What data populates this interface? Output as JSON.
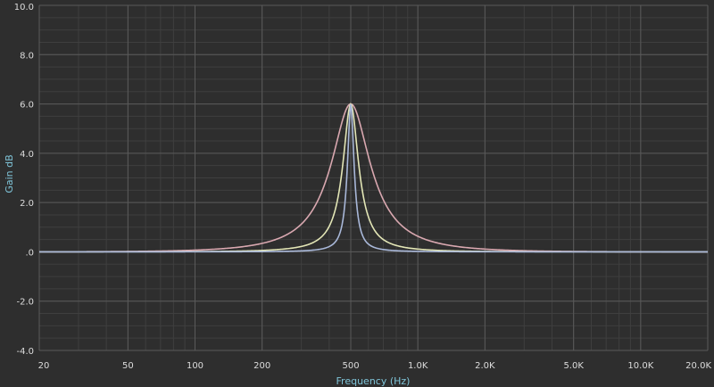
{
  "chart_data": {
    "type": "line",
    "title": "",
    "xlabel": "Frequency (Hz)",
    "ylabel": "Gain dB",
    "x_scale": "log",
    "xlim": [
      20,
      20000
    ],
    "ylim": [
      -4.0,
      10.0
    ],
    "grid": true,
    "legend": "none",
    "x_ticks": [
      {
        "value": 20,
        "label": "20"
      },
      {
        "value": 50,
        "label": "50"
      },
      {
        "value": 100,
        "label": "100"
      },
      {
        "value": 200,
        "label": "200"
      },
      {
        "value": 500,
        "label": "500"
      },
      {
        "value": 1000,
        "label": "1.0K"
      },
      {
        "value": 2000,
        "label": "2.0K"
      },
      {
        "value": 5000,
        "label": "5.0K"
      },
      {
        "value": 10000,
        "label": "10.0K"
      },
      {
        "value": 20000,
        "label": "20.0K"
      }
    ],
    "y_ticks": [
      {
        "value": 10,
        "label": "10.0"
      },
      {
        "value": 8,
        "label": "8.0"
      },
      {
        "value": 6,
        "label": "6.0"
      },
      {
        "value": 4,
        "label": "4.0"
      },
      {
        "value": 2,
        "label": "2.0"
      },
      {
        "value": 0,
        "label": ".0"
      },
      {
        "value": -2,
        "label": "-2.0"
      },
      {
        "value": -4,
        "label": "-4.0"
      }
    ],
    "series": [
      {
        "color": "#d9a8b0",
        "center_hz": 500,
        "gain_db": 6.0,
        "q": 2
      },
      {
        "color": "#e3e6b6",
        "center_hz": 500,
        "gain_db": 6.0,
        "q": 5
      },
      {
        "color": "#a9b8d9",
        "center_hz": 500,
        "gain_db": 6.0,
        "q": 12
      }
    ],
    "colors": {
      "background": "#2e2e2e",
      "grid_major": "#5a5a5a",
      "grid_minor": "#3f3f3f",
      "tick_text": "#dcdcdc",
      "axis_title": "#7fc4d8"
    }
  }
}
